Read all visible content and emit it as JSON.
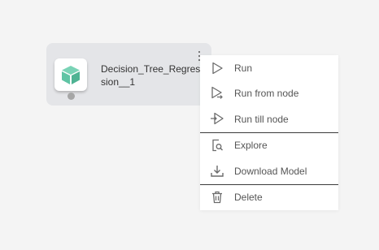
{
  "node": {
    "label": "Decision_Tree_Regression__1",
    "icon": "cube-icon",
    "icon_color": "#5fc4a4"
  },
  "menu": {
    "groups": [
      [
        {
          "label": "Run",
          "icon": "play-icon"
        },
        {
          "label": "Run from node",
          "icon": "run-from-node-icon"
        },
        {
          "label": "Run till node",
          "icon": "run-till-node-icon"
        }
      ],
      [
        {
          "label": "Explore",
          "icon": "explore-icon"
        },
        {
          "label": "Download Model",
          "icon": "download-icon"
        }
      ],
      [
        {
          "label": "Delete",
          "icon": "trash-icon"
        }
      ]
    ]
  }
}
